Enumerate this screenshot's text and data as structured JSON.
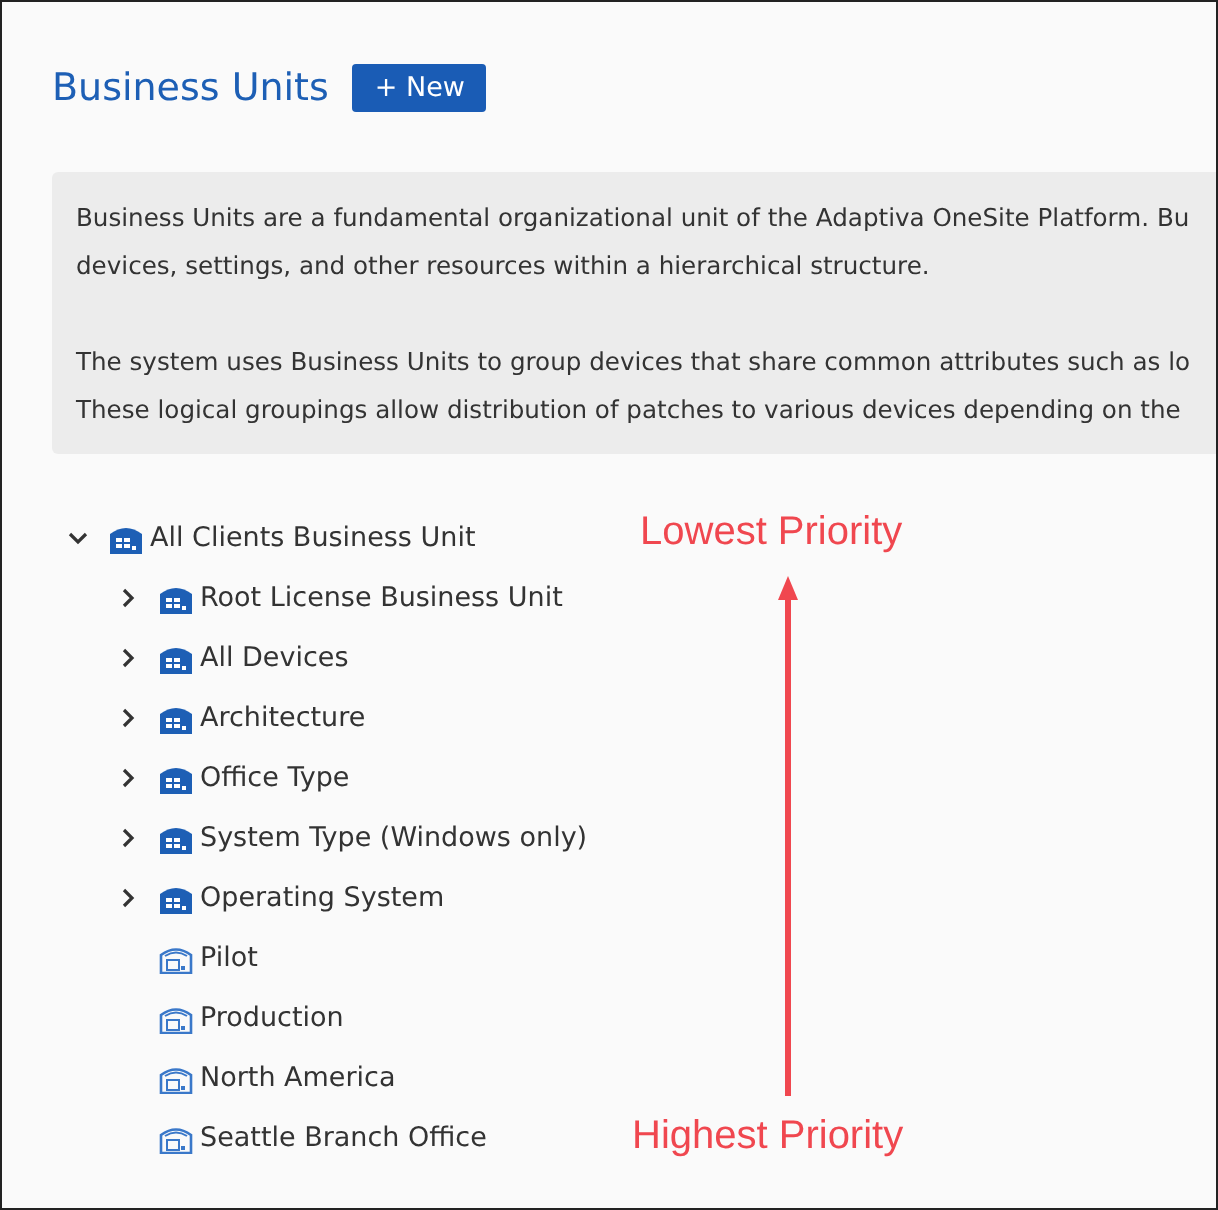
{
  "header": {
    "title": "Business Units",
    "new_button": "+ New"
  },
  "info": {
    "paragraphs": [
      [
        "Business Units are a fundamental organizational unit of the Adaptiva OneSite Platform. Bu",
        "devices, settings, and other resources within a hierarchical structure."
      ],
      [
        "The system uses Business Units to group devices that share common attributes such as lo",
        "These logical groupings allow distribution of patches to various devices depending on the"
      ]
    ]
  },
  "tree": [
    {
      "label": "All Clients Business Unit",
      "kind": "group",
      "expanded": true,
      "children": [
        {
          "label": "Root License Business Unit",
          "kind": "group",
          "expanded": false
        },
        {
          "label": "All Devices",
          "kind": "group",
          "expanded": false
        },
        {
          "label": "Architecture",
          "kind": "group",
          "expanded": false
        },
        {
          "label": "Office Type",
          "kind": "group",
          "expanded": false
        },
        {
          "label": "System Type (Windows only)",
          "kind": "group",
          "expanded": false
        },
        {
          "label": "Operating System",
          "kind": "group",
          "expanded": false
        },
        {
          "label": "Pilot",
          "kind": "leaf"
        },
        {
          "label": "Production",
          "kind": "leaf"
        },
        {
          "label": "North America",
          "kind": "leaf"
        },
        {
          "label": "Seattle Branch Office",
          "kind": "leaf"
        }
      ]
    }
  ],
  "annotation": {
    "top_label": "Lowest Priority",
    "bottom_label": "Highest Priority"
  }
}
